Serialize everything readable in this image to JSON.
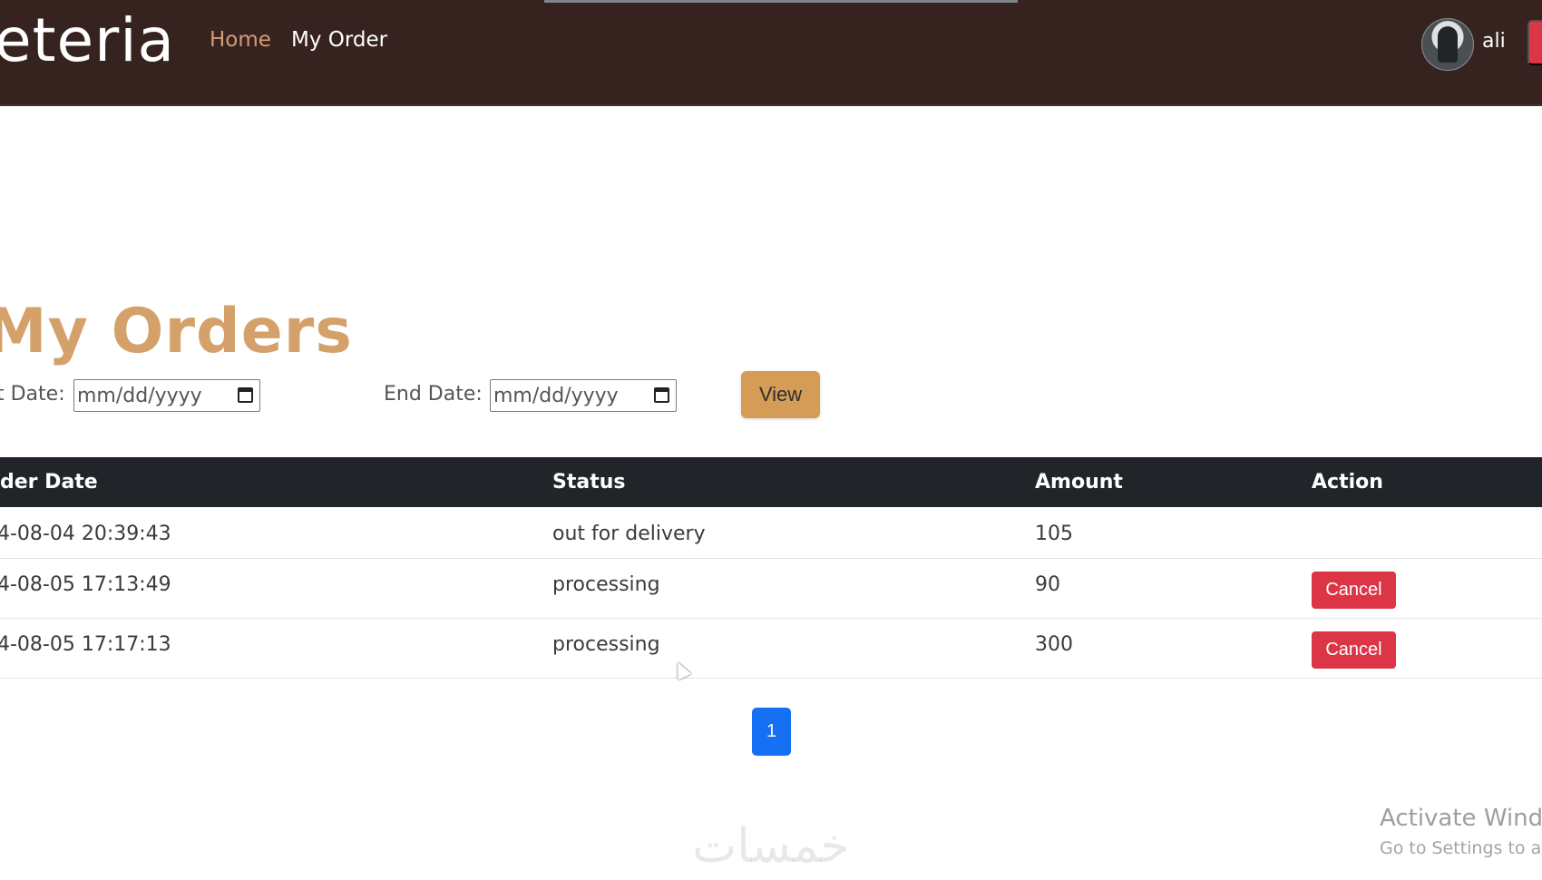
{
  "nav": {
    "brand": "eteria",
    "links": [
      {
        "label": "Home",
        "color": "#d59a78"
      },
      {
        "label": "My Order",
        "color": "#ffffff"
      }
    ],
    "username": "ali"
  },
  "page": {
    "title": "My Orders"
  },
  "filters": {
    "start_label": "t Date:",
    "start_value": "mm/dd/yyyy",
    "end_label": "End Date:",
    "end_value": "mm/dd/yyyy",
    "view_label": "View"
  },
  "table": {
    "headers": [
      "der Date",
      "Status",
      "Amount",
      "Action"
    ],
    "rows": [
      {
        "date": "4-08-04 20:39:43",
        "status": "out for delivery",
        "amount": "105",
        "action": ""
      },
      {
        "date": "4-08-05 17:13:49",
        "status": "processing",
        "amount": "90",
        "action": "Cancel"
      },
      {
        "date": "4-08-05 17:17:13",
        "status": "processing",
        "amount": "300",
        "action": "Cancel"
      }
    ]
  },
  "pagination": {
    "current": "1"
  },
  "os_notice": {
    "title": "Activate Windo",
    "subtitle": "Go to Settings to ac"
  },
  "watermark": {
    "text": "خمسات"
  },
  "colors": {
    "nav_bg": "#36231f",
    "accent": "#d4a16a",
    "view_button": "#d59c57",
    "cancel": "#dc3545",
    "pagination": "#1670f3"
  }
}
